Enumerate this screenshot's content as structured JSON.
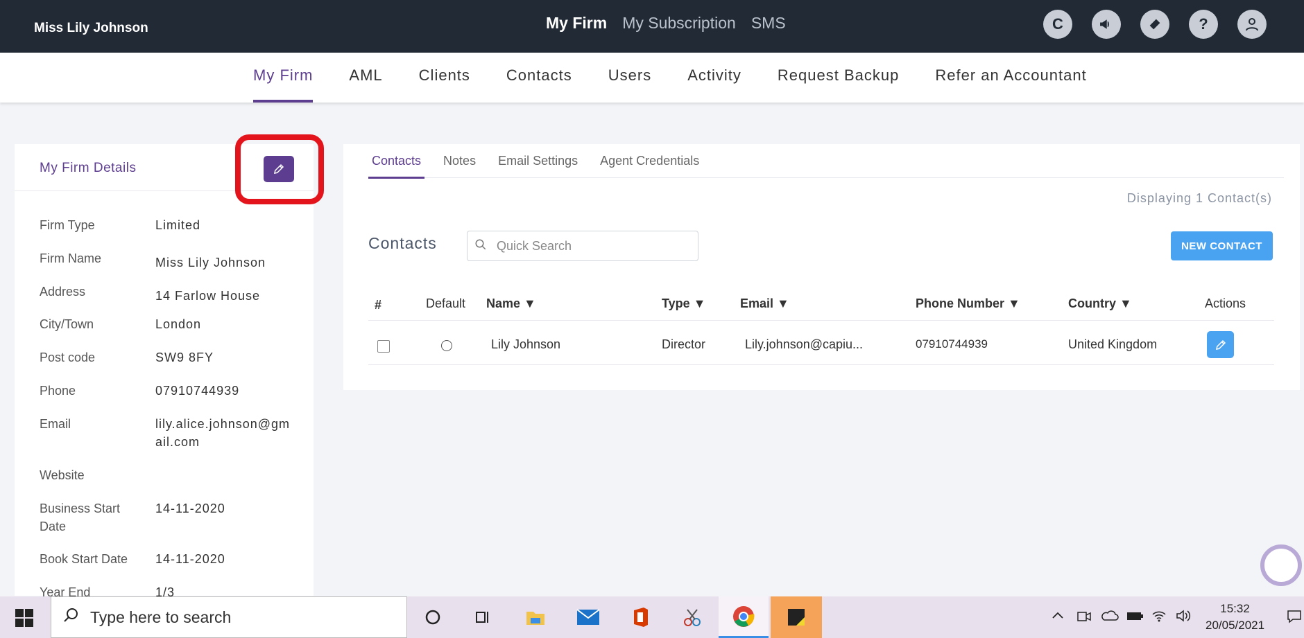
{
  "topbar": {
    "user_name": "Miss Lily Johnson",
    "nav": [
      "My Firm",
      "My Subscription",
      "SMS"
    ],
    "icons": [
      "capium-logo-icon",
      "megaphone-icon",
      "ticket-icon",
      "help-icon",
      "user-icon"
    ]
  },
  "mainnav": {
    "items": [
      "My Firm",
      "AML",
      "Clients",
      "Contacts",
      "Users",
      "Activity",
      "Request Backup",
      "Refer an Accountant"
    ]
  },
  "firm": {
    "title": "My Firm Details",
    "rows": [
      {
        "label": "Firm Type",
        "value": "Limited"
      },
      {
        "label": "Firm Name",
        "value": "Miss Lily Johnson"
      },
      {
        "label": "Address",
        "value": "14 Farlow House"
      },
      {
        "label": "City/Town",
        "value": "London"
      },
      {
        "label": "Post code",
        "value": "SW9 8FY"
      },
      {
        "label": "Phone",
        "value": "07910744939"
      },
      {
        "label": "Email",
        "value": "lily.alice.johnson@gmail.com"
      },
      {
        "label": "Website",
        "value": ""
      },
      {
        "label": "Business Start Date",
        "value": "14-11-2020"
      },
      {
        "label": "Book Start Date",
        "value": "14-11-2020"
      },
      {
        "label": "Year End",
        "value": "1/3"
      }
    ]
  },
  "tabs": [
    "Contacts",
    "Notes",
    "Email Settings",
    "Agent Credentials"
  ],
  "contacts": {
    "displaying": "Displaying 1 Contact(s)",
    "title": "Contacts",
    "search_placeholder": "Quick Search",
    "new_button": "NEW CONTACT",
    "columns": [
      "#",
      "Default",
      "Name ▼",
      "Type ▼",
      "Email ▼",
      "Phone Number ▼",
      "Country ▼",
      "Actions"
    ],
    "rows": [
      {
        "name": "Lily Johnson",
        "type": "Director",
        "email": "Lily.johnson@capiu...",
        "phone": "07910744939",
        "country": "United Kingdom"
      }
    ]
  },
  "taskbar": {
    "search_text": "Type here to search",
    "time": "15:32",
    "date": "20/05/2021"
  }
}
